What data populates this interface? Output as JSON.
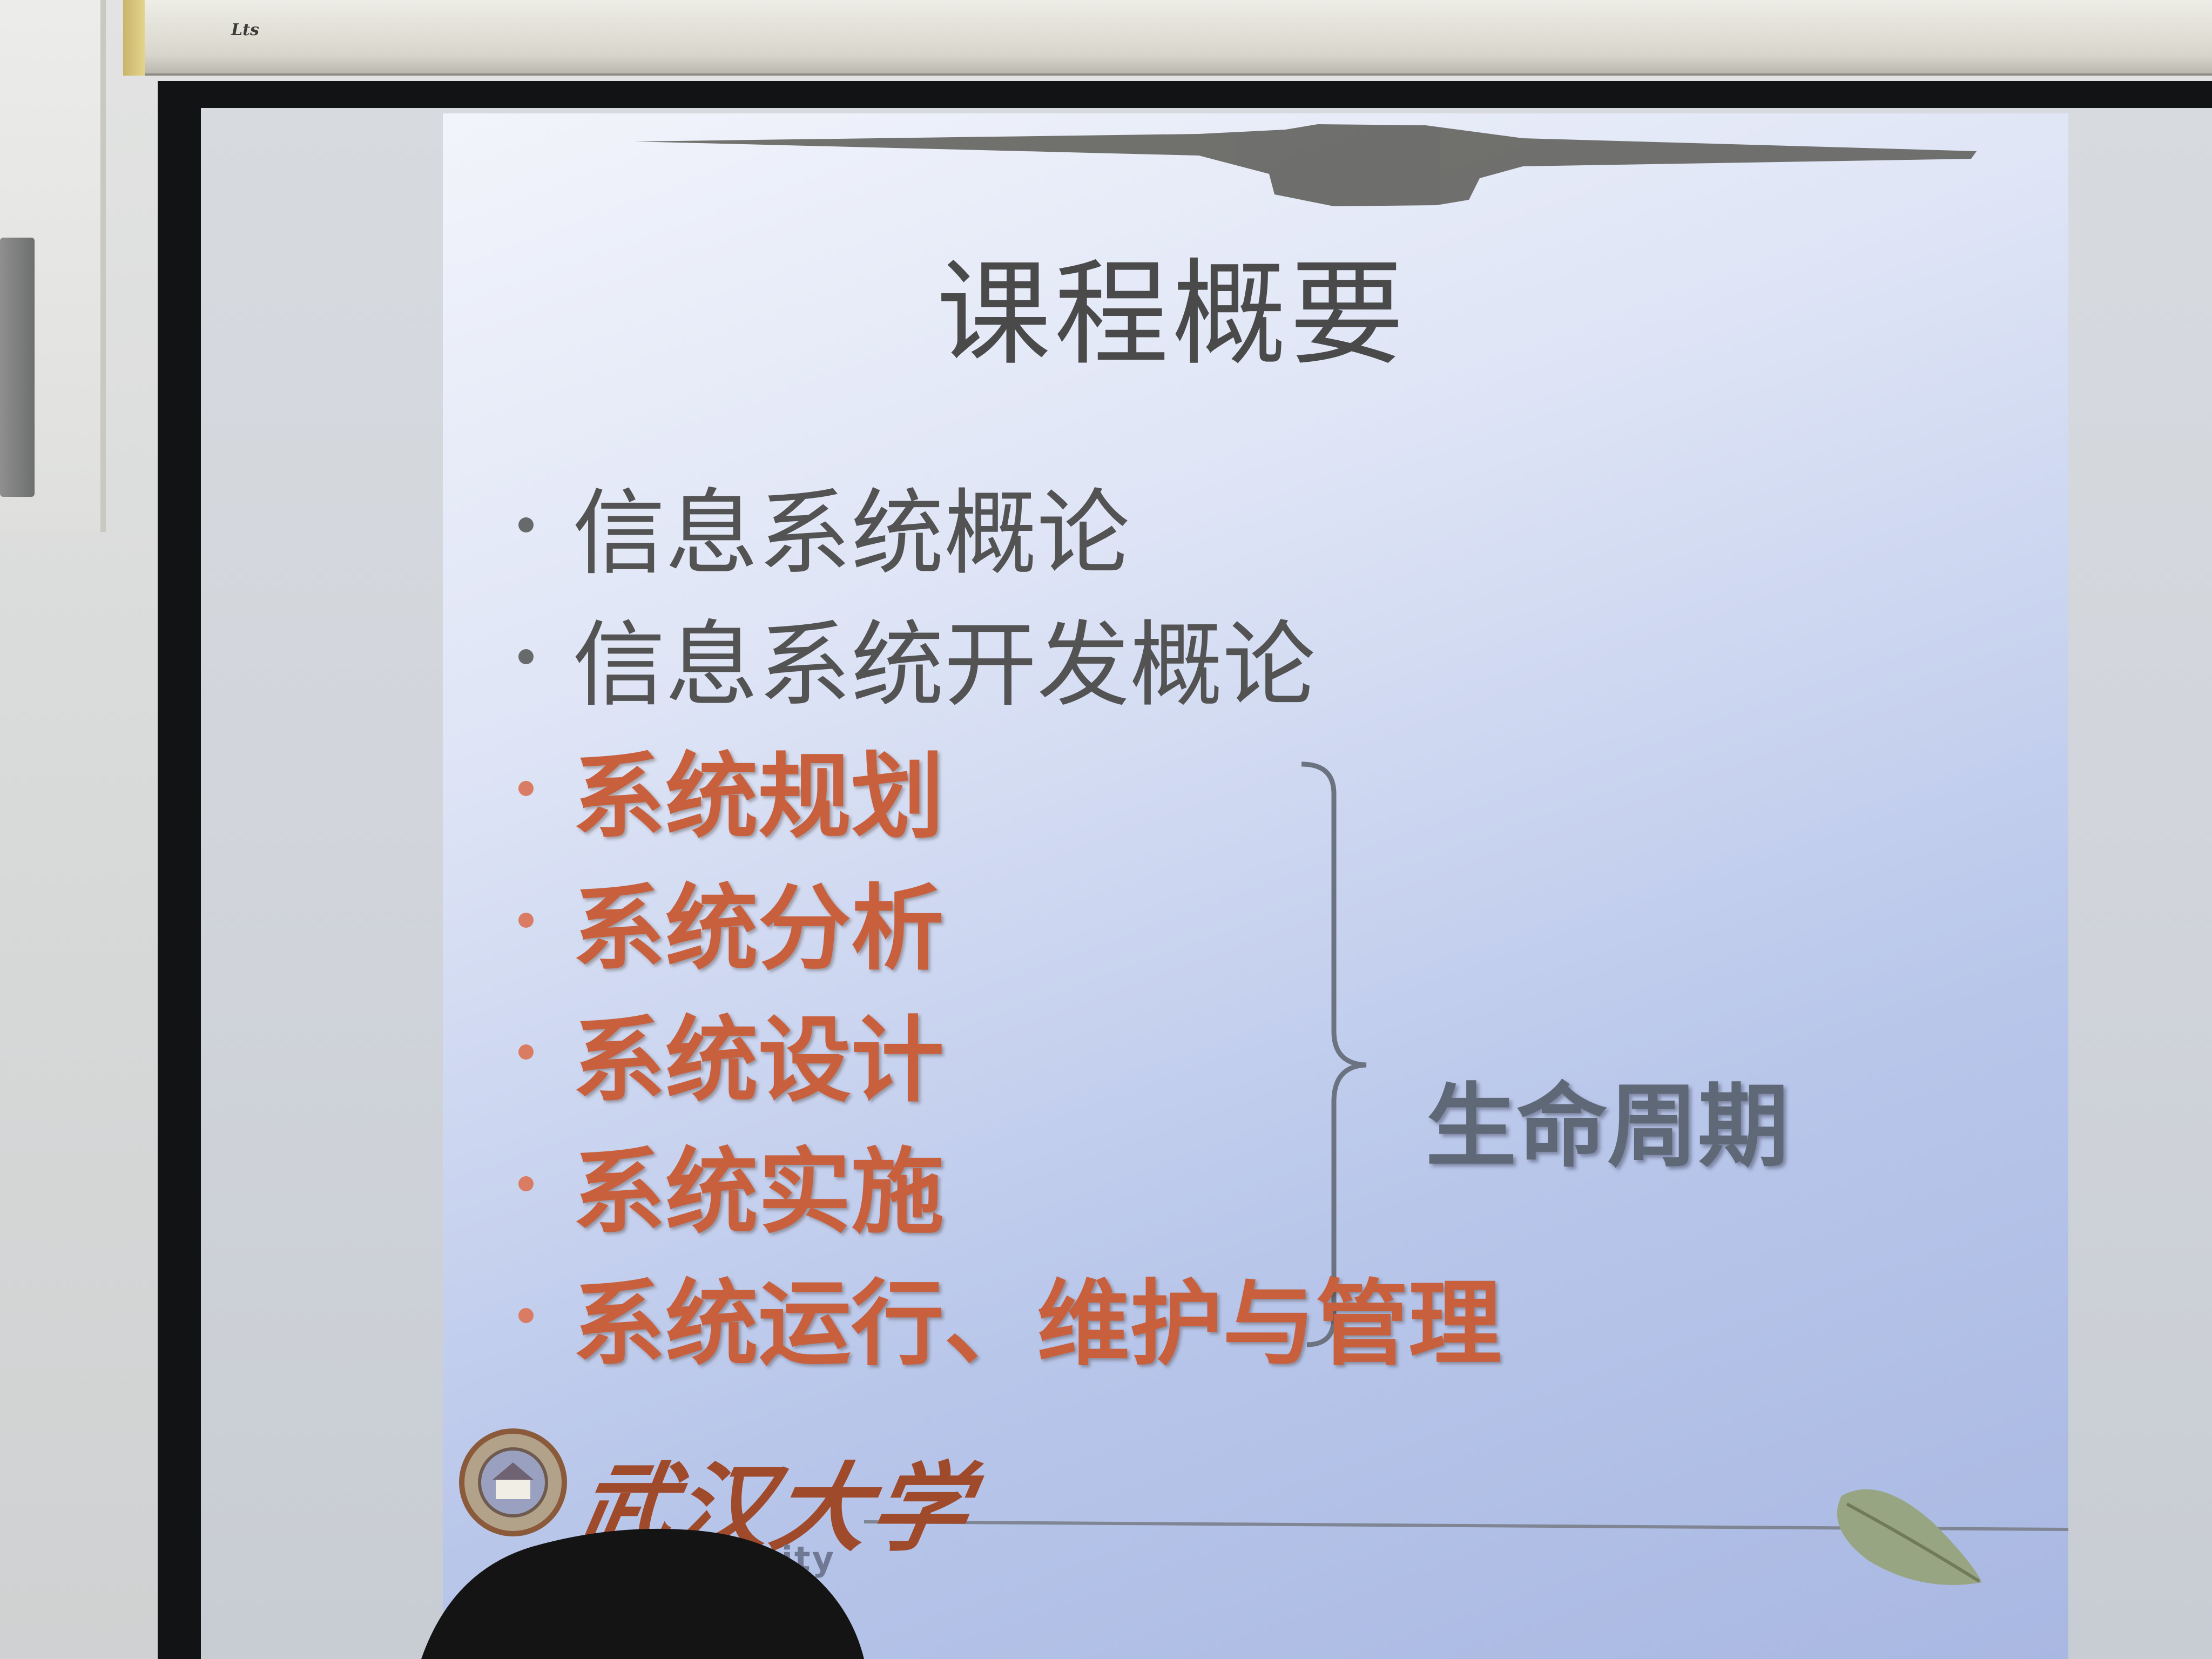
{
  "housing": {
    "brand": "Lts"
  },
  "slide": {
    "title": "课程概要",
    "bullets": [
      {
        "text": "信息系统概论",
        "style": "grey"
      },
      {
        "text": "信息系统开发概论",
        "style": "grey"
      },
      {
        "text": "系统规划",
        "style": "orange"
      },
      {
        "text": "系统分析",
        "style": "orange"
      },
      {
        "text": "系统设计",
        "style": "orange"
      },
      {
        "text": "系统实施",
        "style": "orange"
      },
      {
        "text": "系统运行、维护与管理",
        "style": "orange"
      }
    ],
    "bracket_label": "生命周期",
    "logo_text": "武汉大学",
    "logo_subtext": "University"
  },
  "colors": {
    "bullet_grey": "#535353",
    "bullet_orange": "#c8603d",
    "bracket": "#6b7280",
    "slide_bg": "#b8c6ea"
  },
  "icons": [
    "university-seal-icon",
    "leaf-icon",
    "airplane-silhouette-icon"
  ]
}
